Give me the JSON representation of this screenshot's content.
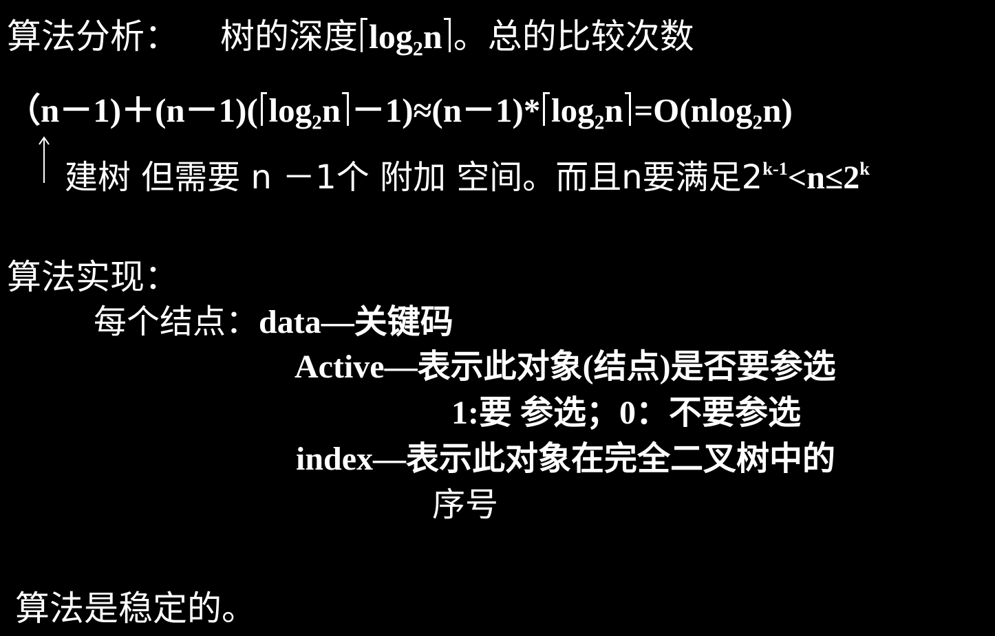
{
  "analysis": {
    "heading": "算法分析：",
    "depth_prefix": "树的深度",
    "log": "log",
    "base": "2",
    "n": "n",
    "depth_suffix": "。总的比较次数"
  },
  "formula": {
    "p1": "（n－1)＋(n－1)(",
    "log_a": "log",
    "base_a": "2",
    "n_a": "n",
    "p2": "－1)≈(n－1)*",
    "log_b": "log",
    "base_b": "2",
    "n_b": "n",
    "p3": "=O(nlog",
    "base_c": "2",
    "p4": "n)"
  },
  "note": {
    "text_a": "建树 但需要 n －1个 附加 空间。而且n要满足2",
    "sup_a": "k-1",
    "text_b": "<n≤2",
    "sup_b": "k"
  },
  "implementation": {
    "heading": "算法实现：",
    "node_label": "每个结点：",
    "data_field": "data—关键码",
    "active_field": "Active—表示此对象(结点)是否要参选",
    "active_values": "1:要 参选；0：不要参选",
    "index_field_1": "index—表示此对象在完全二叉树中的",
    "index_field_2": "序号"
  },
  "conclusion": "算法是稳定的。"
}
